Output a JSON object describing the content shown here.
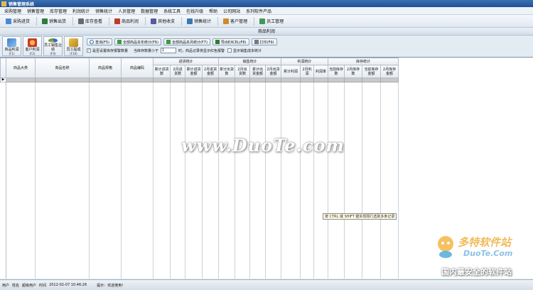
{
  "window": {
    "title": "销售管理系统"
  },
  "menu": [
    "采购管理",
    "销售管理",
    "库存管理",
    "利润统计",
    "销售统计",
    "人员管理",
    "数据管理",
    "系统工具",
    "在线升级",
    "帮助",
    "公司网站",
    "系列软件产品"
  ],
  "toolbar": [
    "采购进货",
    "销售出货",
    "库存查看",
    "商品利润",
    "其他收支",
    "销售统计",
    "客户管理",
    "员工管理"
  ],
  "panel_title": "商品利润",
  "left_buttons": [
    {
      "label": "商品利润",
      "shortcut": "(F1)"
    },
    {
      "label": "客户利润",
      "shortcut": "(F2)"
    },
    {
      "label": "员工销售业绩",
      "shortcut": "(F4)"
    },
    {
      "label": "员工提成",
      "shortcut": "(F10)"
    }
  ],
  "actions": [
    "查询(F5)",
    "全部商品本年统计(F6)",
    "全部商品本月统计(F7)",
    "导出EXCEL(F8)",
    "打印(F9)"
  ],
  "options": {
    "check1": "是否设置库存报警数量",
    "qty_label": "当库存数量小于",
    "qty_value": "1",
    "qty_suffix": "时，商品记录将显示红色报警",
    "check2": "显示销售成本统计"
  },
  "grid": {
    "groups": [
      "进货统计",
      "销售统计",
      "利润统计",
      "库存统计"
    ],
    "columns": [
      "商品大类",
      "商品名称",
      "商品规格",
      "商品编码",
      "累计进货数",
      "2月进货数",
      "累计进货金额",
      "2月进货金额",
      "累计出货数",
      "2月出货数",
      "累计出货金额",
      "2月出货金额",
      "累计利润",
      "2月利润",
      "利润率",
      "当前库存数",
      "2月库存数",
      "当前库存金额",
      "2月库存金额"
    ]
  },
  "tooltip": "按 CTRL 或 SHIFT 键实现隔行选取多条记录",
  "watermark": {
    "center": "www.DuoTe.com",
    "logo_cn": "多特软件站",
    "logo_en": "DuoTe.Com",
    "slogan": "国内最安全的软件站"
  },
  "status": {
    "user_label": "用户",
    "name_label": "姓名",
    "user_name": "超级用户",
    "time_label": "时间",
    "time": "2012-02-07 10:46:26",
    "hint_label": "提示：",
    "hint": "欢迎使用!"
  }
}
